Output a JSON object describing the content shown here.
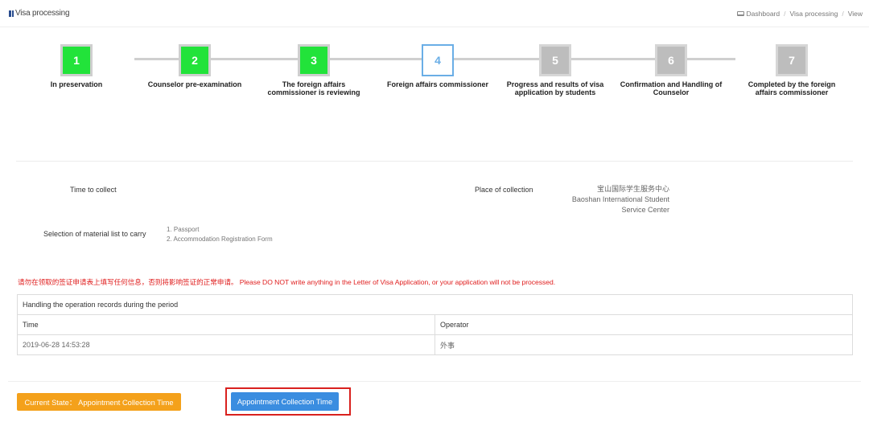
{
  "header": {
    "title": "Visa processing",
    "breadcrumb": [
      "Dashboard",
      "Visa processing",
      "View"
    ]
  },
  "steps": [
    {
      "number": "1",
      "label": "In preservation",
      "status": "done"
    },
    {
      "number": "2",
      "label": "Counselor pre-examination",
      "status": "done"
    },
    {
      "number": "3",
      "label": "The foreign affairs commissioner is reviewing",
      "status": "done"
    },
    {
      "number": "4",
      "label": "Foreign affairs commissioner",
      "status": "active"
    },
    {
      "number": "5",
      "label": "Progress and results of visa application by students",
      "status": "pending"
    },
    {
      "number": "6",
      "label": "Confirmation and Handling of Counselor",
      "status": "pending"
    },
    {
      "number": "7",
      "label": "Completed by the foreign affairs commissioner",
      "status": "pending"
    }
  ],
  "info": {
    "time_to_collect_label": "Time to collect",
    "place_label": "Place of collection",
    "place_value_cn": "宝山国际学生服务中心",
    "place_value_en_1": "Baoshan International Student",
    "place_value_en_2": "Service Center",
    "materials_label": "Selection of material list to carry",
    "materials": [
      "1. Passport",
      "2. Accommodation Registration Form"
    ]
  },
  "warning": "请勿在领取的签证申请表上填写任何信息，否则将影响签证的正常申请。 Please DO NOT write anything in the Letter of Visa Application, or your application will not be processed.",
  "records": {
    "caption": "Handling the operation records during the period",
    "columns": [
      "Time",
      "Operator"
    ],
    "rows": [
      [
        "2019-06-28 14:53:28",
        "外事"
      ]
    ]
  },
  "footer": {
    "current_state": "Current State： Appointment Collection Time",
    "action_label": "Appointment Collection Time"
  },
  "colors": {
    "done": "#22e33a",
    "active": "#6aaee6",
    "pending": "#bdbdbd",
    "warning": "#e02020",
    "state_button": "#f4a11b",
    "action_button": "#3a8de0",
    "highlight": "#d9211e"
  }
}
